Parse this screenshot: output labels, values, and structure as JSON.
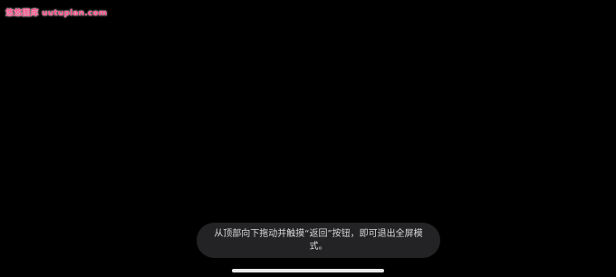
{
  "watermark": {
    "text": "悠悠图库 uutuplan.com"
  },
  "toast": {
    "message": "从顶部向下拖动并触摸“返回”按钮，即可退出全屏模式。"
  },
  "colors": {
    "background": "#000000",
    "toast_background": "#232325",
    "toast_text": "#d8d8d8",
    "watermark": "#ff4d8a",
    "home_indicator": "#e8e8e8"
  }
}
